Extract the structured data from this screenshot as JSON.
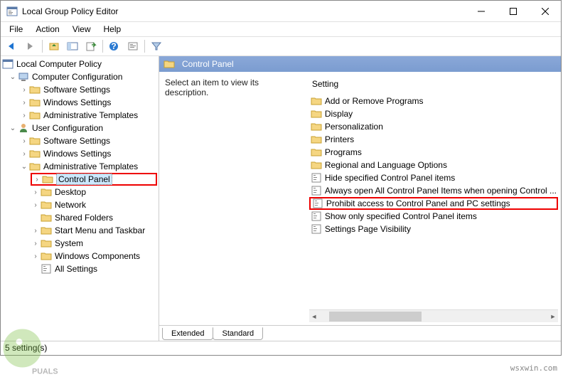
{
  "window": {
    "title": "Local Group Policy Editor"
  },
  "menu": {
    "file": "File",
    "action": "Action",
    "view": "View",
    "help": "Help"
  },
  "tree": {
    "root": "Local Computer Policy",
    "comp": "Computer Configuration",
    "comp_soft": "Software Settings",
    "comp_win": "Windows Settings",
    "comp_admin": "Administrative Templates",
    "user": "User Configuration",
    "user_soft": "Software Settings",
    "user_win": "Windows Settings",
    "user_admin": "Administrative Templates",
    "cp": "Control Panel",
    "desktop": "Desktop",
    "network": "Network",
    "shared": "Shared Folders",
    "startmenu": "Start Menu and Taskbar",
    "system": "System",
    "wincomp": "Windows Components",
    "allsettings": "All Settings"
  },
  "path": {
    "title": "Control Panel"
  },
  "desc": {
    "prompt": "Select an item to view its description."
  },
  "settings_header": "Setting",
  "settings": {
    "add_remove": "Add or Remove Programs",
    "display": "Display",
    "personalization": "Personalization",
    "printers": "Printers",
    "programs": "Programs",
    "regional": "Regional and Language Options",
    "hide": "Hide specified Control Panel items",
    "always_open": "Always open All Control Panel Items when opening Control ...",
    "prohibit": "Prohibit access to Control Panel and PC settings",
    "show_only": "Show only specified Control Panel items",
    "page_vis": "Settings Page Visibility"
  },
  "tabs": {
    "extended": "Extended",
    "standard": "Standard"
  },
  "status": "5 setting(s)",
  "watermark": "wsxwin.com"
}
